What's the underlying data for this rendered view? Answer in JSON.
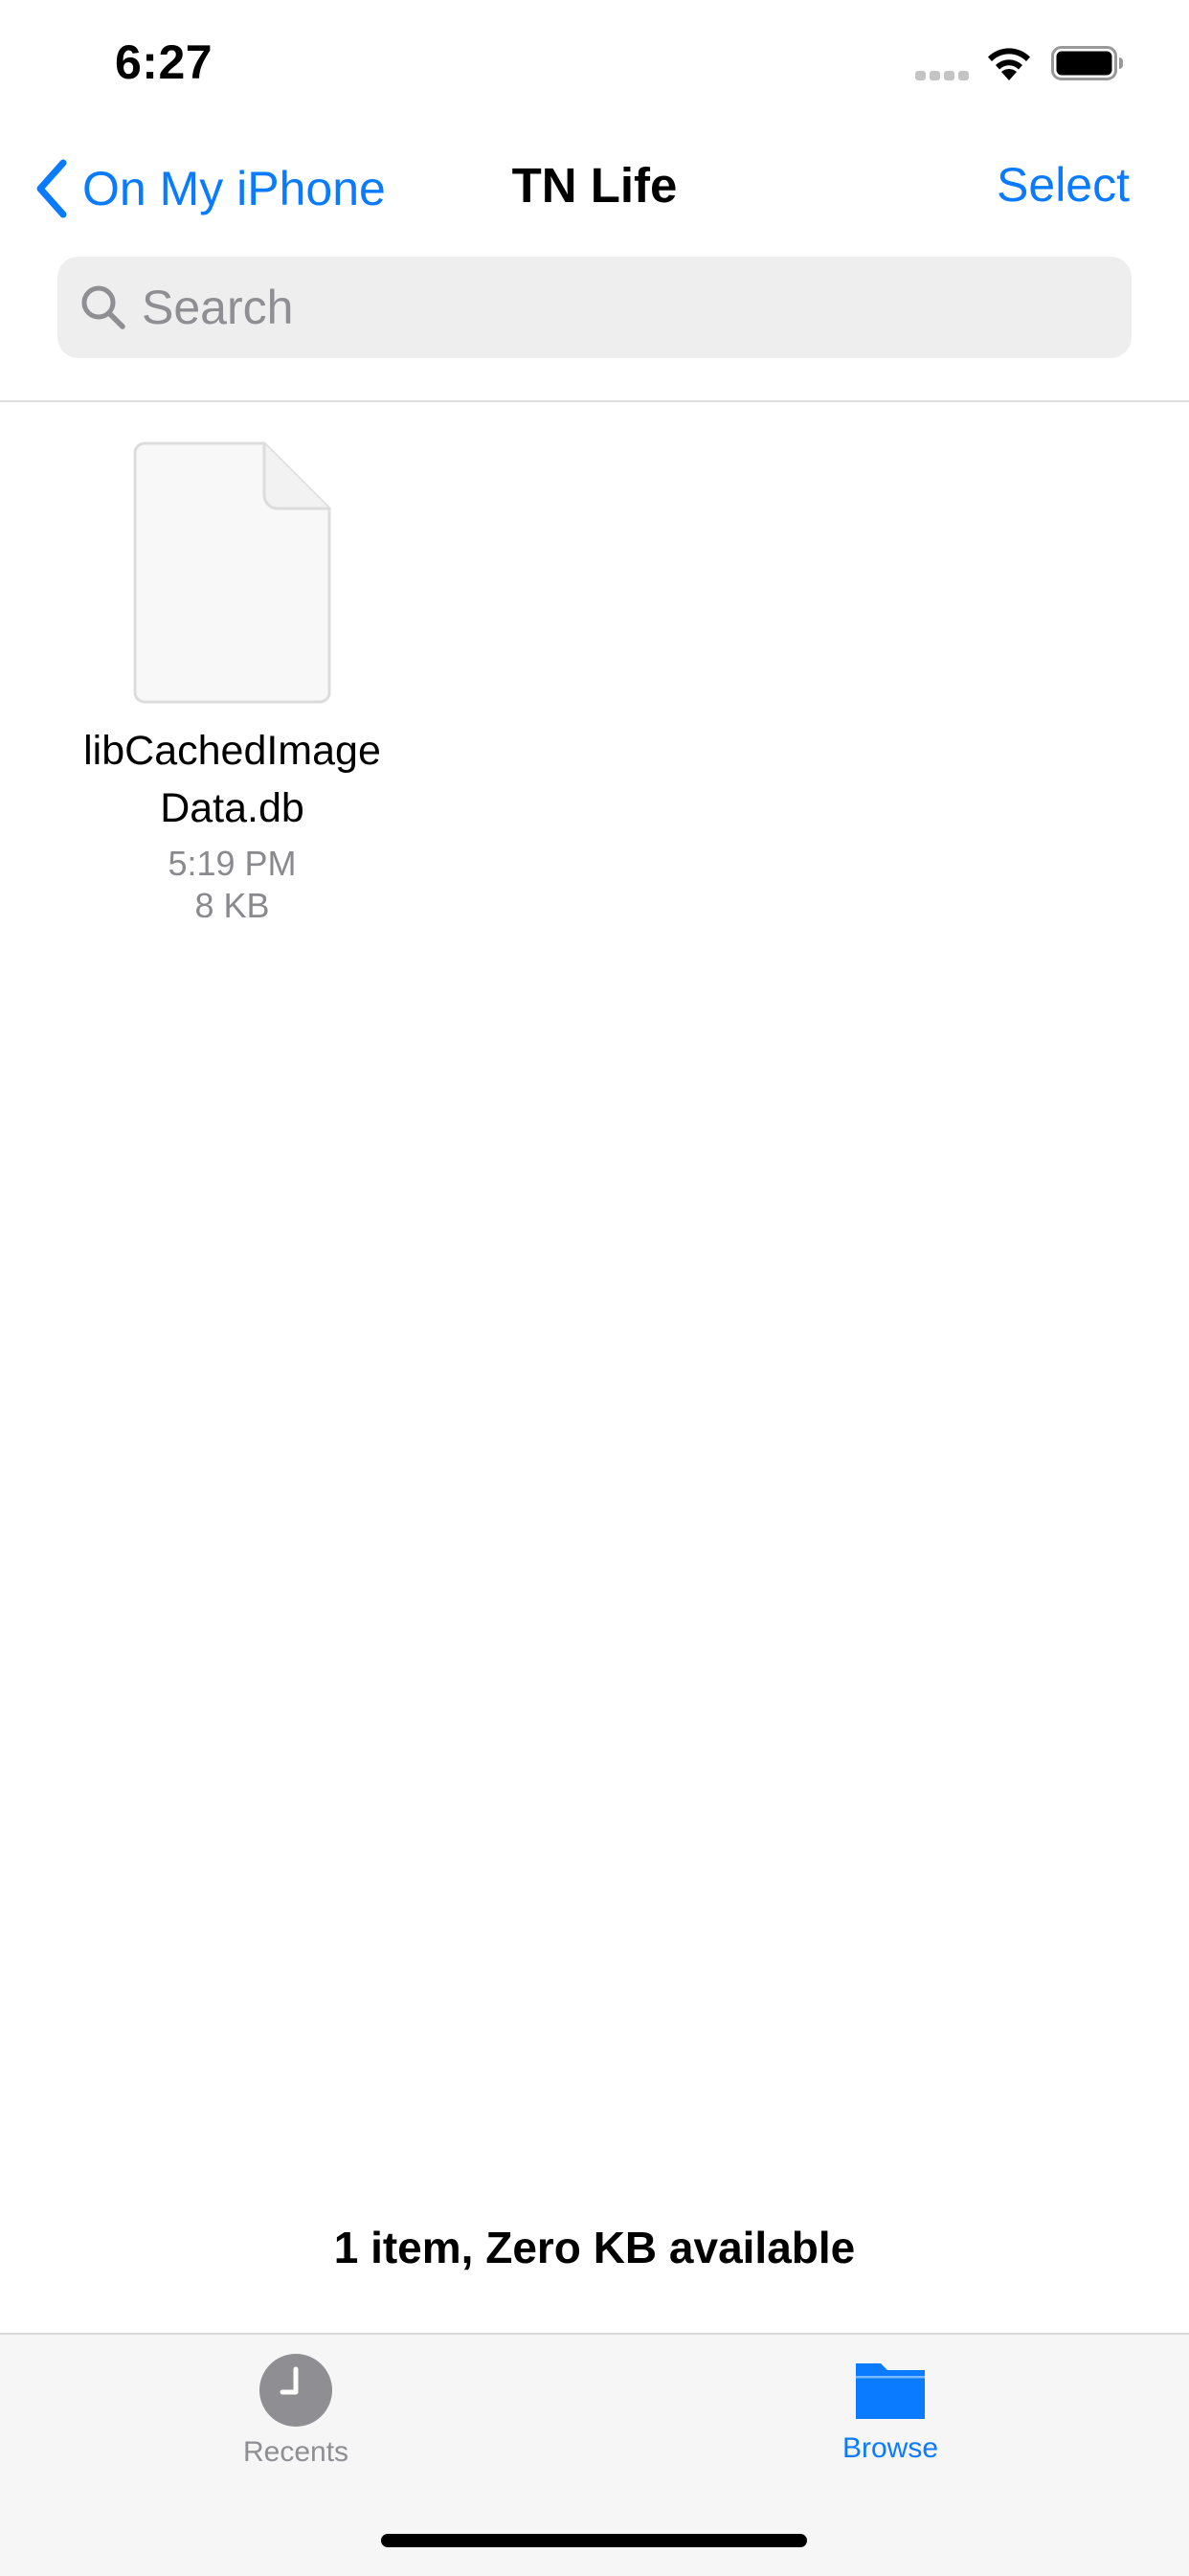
{
  "status_bar": {
    "time": "6:27",
    "icons": [
      "cellular-signal-icon",
      "wifi-icon",
      "battery-icon"
    ]
  },
  "nav": {
    "back_label": "On My iPhone",
    "title": "TN Life",
    "select_label": "Select"
  },
  "search": {
    "placeholder": "Search",
    "value": ""
  },
  "files": [
    {
      "name": "libCachedImageData.db",
      "modified": "5:19 PM",
      "size": "8 KB",
      "icon": "document-icon"
    }
  ],
  "summary": "1 item, Zero KB available",
  "tabs": [
    {
      "label": "Recents",
      "icon": "clock-icon",
      "active": false
    },
    {
      "label": "Browse",
      "icon": "folder-icon",
      "active": true
    }
  ],
  "colors": {
    "accent": "#0a7bff",
    "secondary_text": "#8a8a8e",
    "search_background": "#eeeeef",
    "tab_bar_background": "#f6f6f7"
  }
}
